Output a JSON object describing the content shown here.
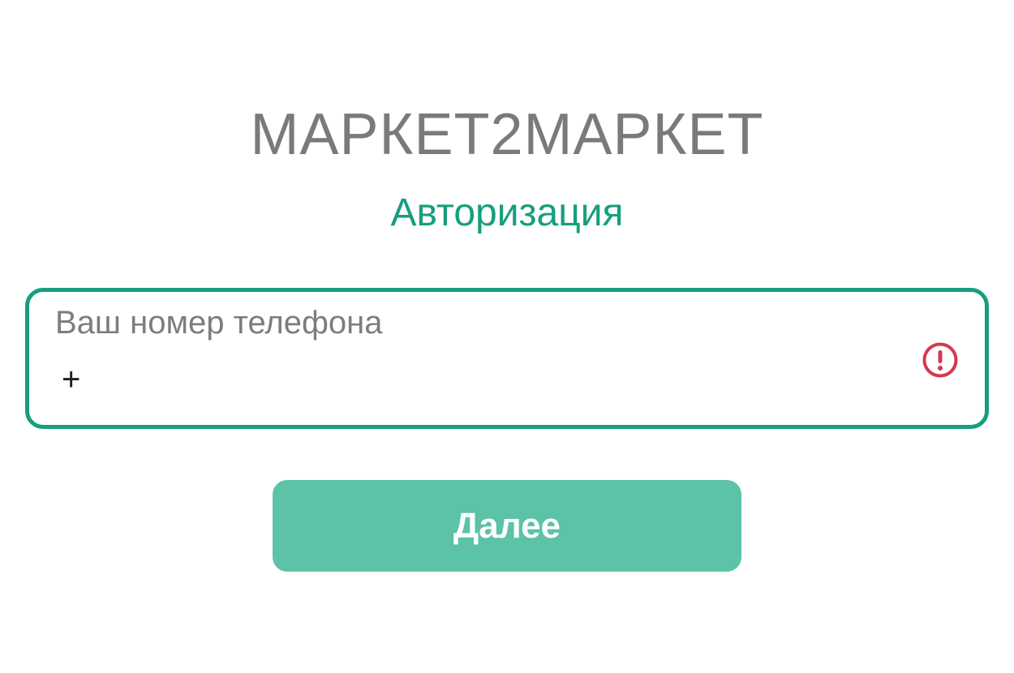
{
  "app": {
    "brand": "МАРКЕТ2МАРКЕТ",
    "subtitle": "Авторизация"
  },
  "form": {
    "phone_label": "Ваш номер телефона",
    "phone_value": "+",
    "error_icon": "exclamation-circle-icon",
    "next_label": "Далее"
  },
  "colors": {
    "brand_text": "#7a7a7a",
    "accent": "#179e7e",
    "button": "#5cc2a8",
    "error": "#d6384f"
  }
}
